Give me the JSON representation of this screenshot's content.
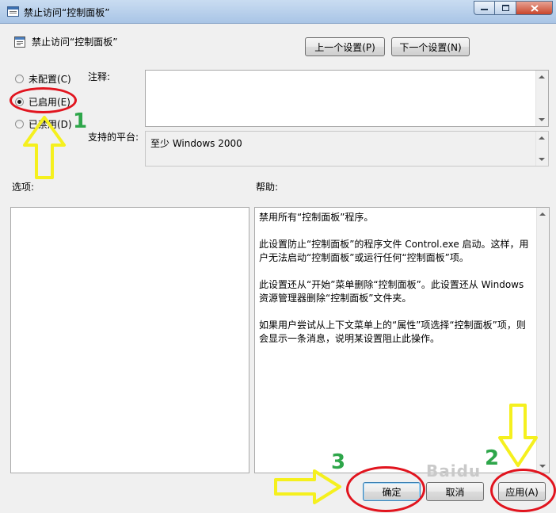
{
  "window": {
    "title": "禁止访问“控制面板”"
  },
  "header": {
    "policy_title": "禁止访问“控制面板”",
    "prev_label": "上一个设置(P)",
    "next_label": "下一个设置(N)"
  },
  "state": {
    "options": [
      {
        "label": "未配置(C)",
        "checked": false
      },
      {
        "label": "已启用(E)",
        "checked": true
      },
      {
        "label": "已禁用(D)",
        "checked": false
      }
    ]
  },
  "comment": {
    "label": "注释:",
    "value": ""
  },
  "platform": {
    "label": "支持的平台:",
    "value": "至少 Windows 2000"
  },
  "options_panel": {
    "label": "选项:"
  },
  "help": {
    "label": "帮助:",
    "paragraphs": [
      "禁用所有“控制面板”程序。",
      "此设置防止“控制面板”的程序文件 Control.exe 启动。这样，用户无法启动“控制面板”或运行任何“控制面板”项。",
      "此设置还从“开始”菜单删除“控制面板”。此设置还从 Windows 资源管理器删除“控制面板”文件夹。",
      "如果用户尝试从上下文菜单上的“属性”项选择“控制面板”项，则会显示一条消息，说明某设置阻止此操作。"
    ]
  },
  "footer": {
    "ok_label": "确定",
    "cancel_label": "取消",
    "apply_label": "应用(A)"
  },
  "annotations": {
    "step1": "1",
    "step2": "2",
    "step3": "3",
    "ellipse_color": "#e1141e",
    "number_color": "#2ea64a",
    "arrow_color": "#f5f01e"
  },
  "watermark": "Baidu"
}
